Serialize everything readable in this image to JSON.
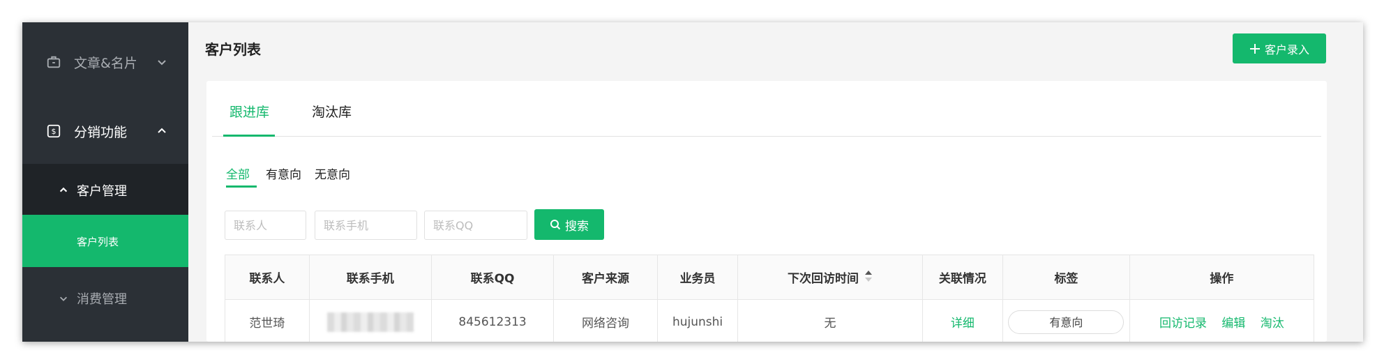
{
  "sidebar": {
    "group_articles": "文章&名片",
    "group_distribution": "分销功能",
    "sub_customer_mgmt": "客户管理",
    "sub_customer_list": "客户列表",
    "group_consumption": "消费管理"
  },
  "header": {
    "title": "客户列表",
    "add_button": "客户录入"
  },
  "tabs": [
    "跟进库",
    "淘汰库"
  ],
  "active_tab": "跟进库",
  "filters": [
    "全部",
    "有意向",
    "无意向"
  ],
  "active_filter": "全部",
  "search": {
    "contact_placeholder": "联系人",
    "phone_placeholder": "联系手机",
    "qq_placeholder": "联系QQ",
    "button": "搜索"
  },
  "table": {
    "columns": [
      "联系人",
      "联系手机",
      "联系QQ",
      "客户来源",
      "业务员",
      "下次回访时间",
      "关联情况",
      "标签",
      "操作"
    ],
    "rows": [
      {
        "contact": "范世琦",
        "phone": "",
        "qq": "845612313",
        "source": "网络咨询",
        "salesman": "hujunshi",
        "next_visit": "无",
        "relation": "详细",
        "tag": "有意向",
        "ops": [
          "回访记录",
          "编辑",
          "淘汰"
        ]
      }
    ]
  },
  "colors": {
    "accent": "#14b86d",
    "sidebar_bg": "#2b3036",
    "sidebar_sub_bg": "#1f2327"
  }
}
